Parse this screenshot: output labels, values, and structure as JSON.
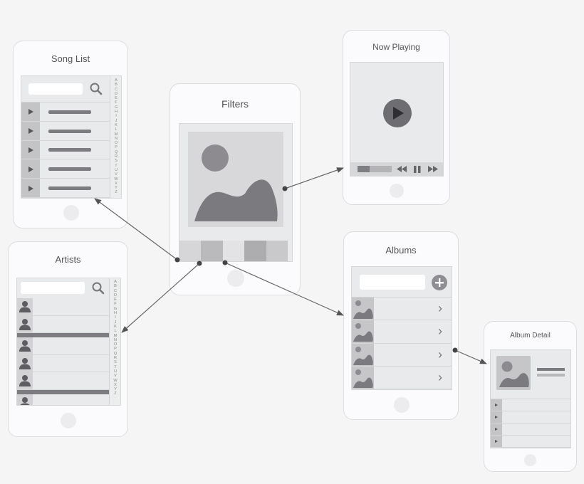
{
  "diagram": {
    "type": "mobile-wireframe-flow",
    "screens": {
      "song_list": {
        "title": "Song List",
        "rows": 5,
        "row_icon": "play-triangle"
      },
      "artists": {
        "title": "Artists",
        "rows": 6,
        "row_icon": "person"
      },
      "filters": {
        "title": "Filters",
        "filter_swatches": 5
      },
      "now_playing": {
        "title": "Now Playing",
        "controls": [
          "rewind",
          "pause",
          "fast-forward"
        ],
        "progress": 0.35
      },
      "albums": {
        "title": "Albums",
        "rows": 4,
        "row_icon": "image-thumbnail",
        "add_button_icon": "plus"
      },
      "album_detail": {
        "title": "Album Detail",
        "tracks": 4
      }
    },
    "index_letters": [
      "A",
      "B",
      "C",
      "D",
      "E",
      "F",
      "G",
      "H",
      "I",
      "J",
      "K",
      "L",
      "M",
      "N",
      "O",
      "P",
      "Q",
      "R",
      "S",
      "T",
      "U",
      "V",
      "W",
      "X",
      "Y",
      "Z"
    ],
    "connections": [
      {
        "from": "filters",
        "to": "song_list"
      },
      {
        "from": "filters",
        "to": "artists"
      },
      {
        "from": "filters",
        "to": "albums"
      },
      {
        "from": "filters",
        "to": "now_playing"
      },
      {
        "from": "albums",
        "to": "album_detail"
      }
    ],
    "colors": {
      "background": "#f5f5f6",
      "phone": "#fbfbfd",
      "screen": "#e9eaeb",
      "dark_gray": "#7c7c80",
      "connector": "#555555"
    }
  }
}
